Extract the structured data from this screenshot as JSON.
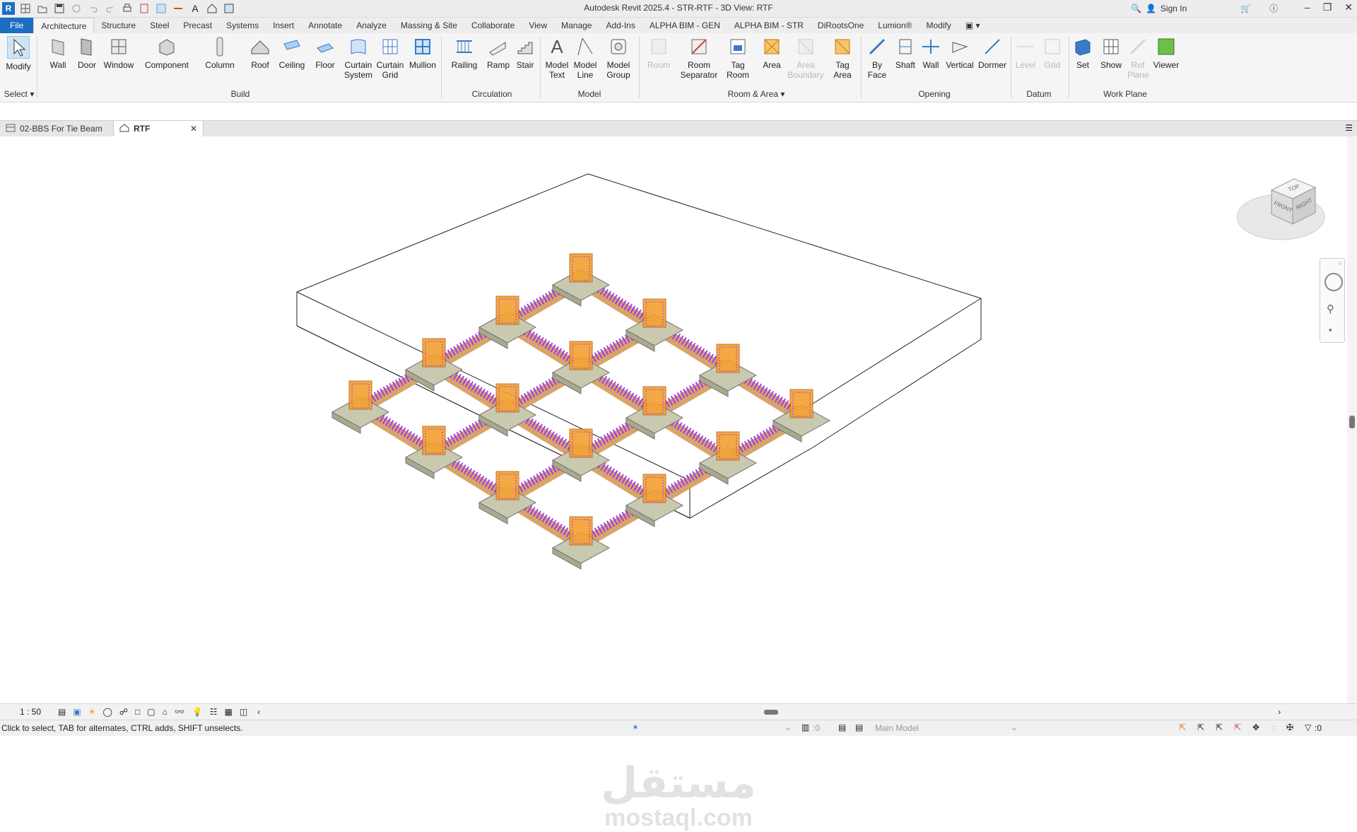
{
  "app_title": "Autodesk Revit 2025.4 - STR-RTF - 3D View: RTF",
  "signin": "Sign In",
  "menu_tabs": [
    "File",
    "Architecture",
    "Structure",
    "Steel",
    "Precast",
    "Systems",
    "Insert",
    "Annotate",
    "Analyze",
    "Massing & Site",
    "Collaborate",
    "View",
    "Manage",
    "Add-Ins",
    "ALPHA BIM - GEN",
    "ALPHA BIM - STR",
    "DiRootsOne",
    "Lumion®",
    "Modify"
  ],
  "active_tab": "Architecture",
  "ribbon": {
    "modify": "Modify",
    "select": "Select",
    "build": [
      "Wall",
      "Door",
      "Window",
      "Component",
      "Column",
      "Roof",
      "Ceiling",
      "Floor",
      "Curtain System",
      "Curtain Grid",
      "Mullion"
    ],
    "build_label": "Build",
    "circulation": [
      "Railing",
      "Ramp",
      "Stair"
    ],
    "circulation_label": "Circulation",
    "model": [
      "Model Text",
      "Model Line",
      "Model Group"
    ],
    "model_label": "Model",
    "room_area": [
      "Room",
      "Room Separator",
      "Tag Room",
      "Area",
      "Area Boundary",
      "Tag Area"
    ],
    "room_area_label": "Room & Area",
    "opening": [
      "By Face",
      "Shaft",
      "Wall",
      "Vertical",
      "Dormer"
    ],
    "opening_label": "Opening",
    "datum": [
      "Level",
      "Grid"
    ],
    "datum_label": "Datum",
    "work_plane": [
      "Set",
      "Show",
      "Ref Plane",
      "Viewer"
    ],
    "work_plane_label": "Work Plane"
  },
  "doc_tabs": [
    {
      "label": "02-BBS For Tie Beam",
      "active": false
    },
    {
      "label": "RTF",
      "active": true
    }
  ],
  "viewcube": {
    "top": "TOP",
    "front": "FRONT",
    "right": "RIGHT"
  },
  "view_scale": "1 : 50",
  "status_text": "Click to select, TAB for alternates, CTRL adds, SHIFT unselects.",
  "status_zero_a": ":0",
  "model_name": "Main Model",
  "filter_count": ":0",
  "watermark_ar": "مستقل",
  "watermark_en": "mostaql.com",
  "colors": {
    "accent": "#1b6ec2",
    "footing": "#c9c9b0",
    "column": "#f5a030",
    "rebar": "#9b3cf0"
  }
}
